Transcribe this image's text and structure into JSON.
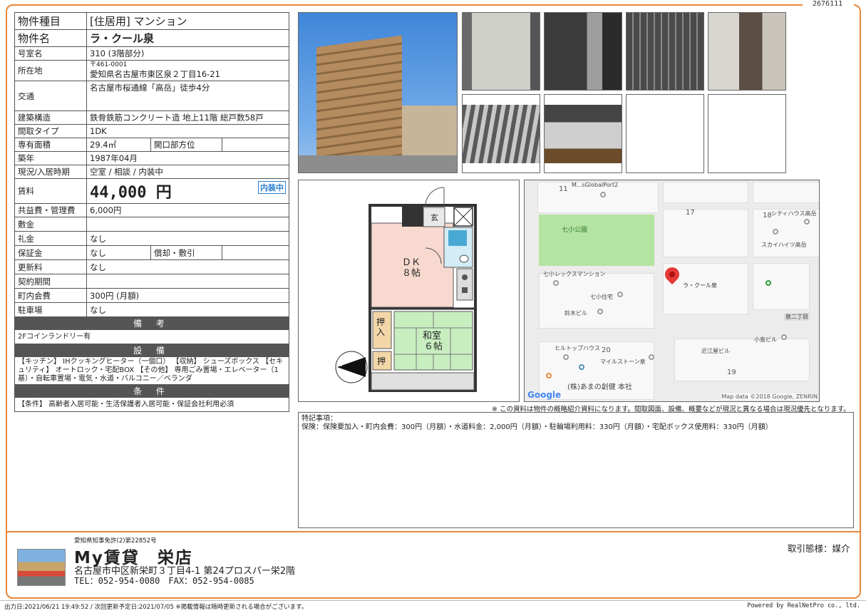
{
  "doc_number": "2676111",
  "property": {
    "type_label": "物件種目",
    "type_value": "[住居用] マンション",
    "name_label": "物件名",
    "name_value": "ラ・クール泉",
    "room_label": "号室名",
    "room_value": "310 (3階部分)",
    "location_label": "所在地",
    "postal": "〒461-0001",
    "address": "愛知県名古屋市東区泉２丁目16-21",
    "transit_label": "交通",
    "transit_value": "名古屋市桜通線「高岳」徒歩4分",
    "structure_label": "建築構造",
    "structure_value": "鉄骨鉄筋コンクリート造 地上11階 総戸数58戸",
    "layout_label": "間取タイプ",
    "layout_value": "1DK",
    "area_label": "専有面積",
    "area_value": "29.4㎡",
    "direction_label": "開口部方位",
    "direction_value": "",
    "built_label": "築年",
    "built_value": "1987年04月",
    "status_label": "現況/入居時期",
    "status_value": "空室 / 相談 / 内装中",
    "rent_label": "賃料",
    "rent_value": "44,000 円",
    "rent_badge": "内装中",
    "fee_label": "共益費・管理費",
    "fee_value": "6,000円",
    "deposit_label": "敷金",
    "deposit_value": "",
    "keymoney_label": "礼金",
    "keymoney_value": "なし",
    "guarantee_label": "保証金",
    "guarantee_value": "なし",
    "amort_label": "償却・敷引",
    "amort_value": "",
    "renewal_label": "更新料",
    "renewal_value": "なし",
    "contract_label": "契約期間",
    "contract_value": "",
    "community_label": "町内会費",
    "community_value": "300円 (月額)",
    "parking_label": "駐車場",
    "parking_value": "なし"
  },
  "sections": {
    "remarks_title": "備 考",
    "remarks_text": "2Fコインランドリー有",
    "equipment_title": "設 備",
    "equipment_text": "【キッチン】 IHクッキングヒーター（一個口） 【収納】 シューズボックス 【セキュリティ】 オートロック・宅配BOX 【その他】 専用ごみ置場・エレベーター（1基）・自転車置場・電気・水道・バルコニー／ベランダ",
    "conditions_title": "条 件",
    "conditions_text": "【条件】 高齢者入居可能・生活保護者入居可能・保証会社利用必須"
  },
  "floorplan": {
    "entrance": "玄",
    "dk_line1": "ＤＫ",
    "dk_line2": "８帖",
    "washitsu_line1": "和室",
    "washitsu_line2": "６帖",
    "closet1": "押入",
    "closet2": "押",
    "compass": "N"
  },
  "map": {
    "labels": [
      "M...sGlobalPort2",
      "七小公園",
      "シティハウス高岳",
      "スカイハイツ高岳",
      "七小レックスマンション",
      "七小住宅",
      "ラ・クール泉",
      "鈴木ビル",
      "泉二丁目",
      "小島ビル",
      "ヒルトップハウス",
      "マイルストーン泉",
      "近江屋ビル",
      "(株)あまの創健 本社"
    ],
    "numbers": [
      "11",
      "17",
      "18",
      "20",
      "19"
    ],
    "google": "Google",
    "copyright": "Map data ©2018 Google, ZENRIN"
  },
  "disclaimer": "※ この資料は物件の概略紹介資料になります。間取図面、設備、概要などが現況と異なる場合は現況優先となります。",
  "special": {
    "title": "特記事項：",
    "text": "保険：保険要加入・町内会費：300円（月額）・水道料金：2,000円（月額）・駐輪場利用料：330円（月額）・宅配ボックス使用料：330円（月額）"
  },
  "agent": {
    "license": "愛知県知事免許(2)第22852号",
    "name": "My賃貸　栄店",
    "address": "名古屋市中区新栄町３丁目4-1 第24プロスパー栄2階",
    "tel": "TEL：052-954-0080　FAX：052-954-0085",
    "trade": "取引態様：媒介"
  },
  "footer": {
    "left": "出力日:2021/06/21 19:49:52 / 次回更新予定日:2021/07/05 ※掲載情報は随時更新される場合がございます。",
    "right": "Powered by RealNetPro co., ltd."
  }
}
